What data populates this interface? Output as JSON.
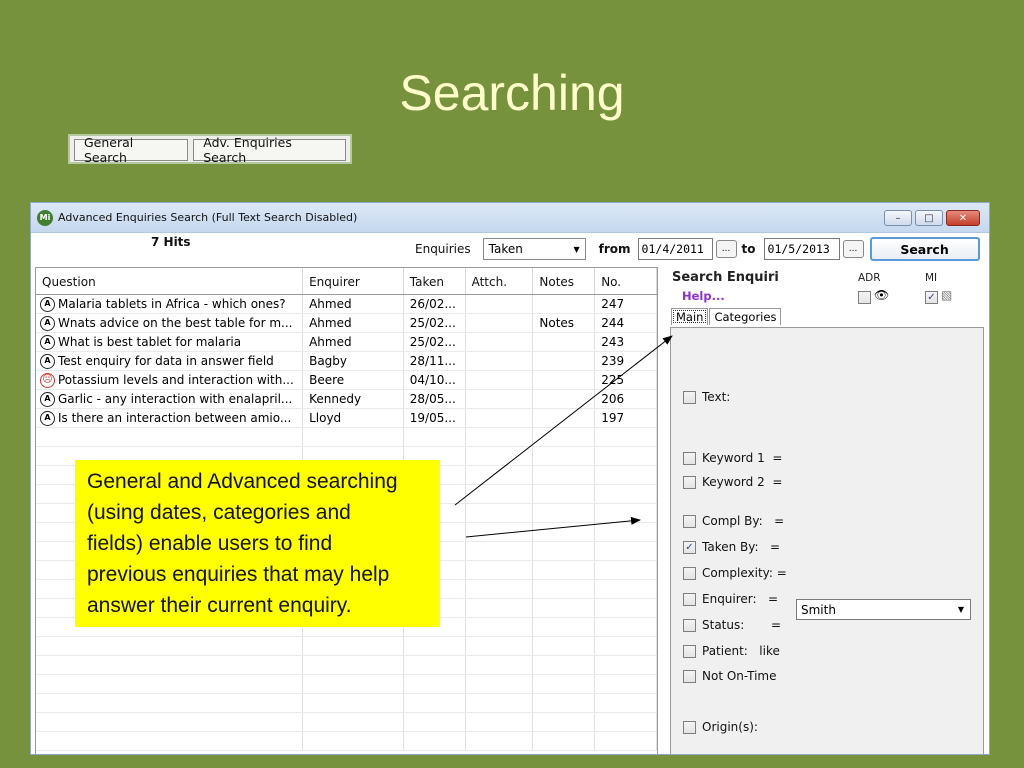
{
  "slide": {
    "title": "Searching"
  },
  "top_buttons": {
    "general": "General Search",
    "advanced": "Adv. Enquiries Search"
  },
  "window": {
    "title": "Advanced Enquiries Search (Full Text Search Disabled)",
    "icon_text": "Mi",
    "controls": {
      "minimize": "–",
      "maximize": "□",
      "close": "✕"
    }
  },
  "toolbar": {
    "hits": "7 Hits",
    "enquiries_label": "Enquiries",
    "enquiries_select": "Taken",
    "from_label": "from",
    "from_date": "01/4/2011",
    "dots": "...",
    "to_label": "to",
    "to_date": "01/5/2013",
    "search_button": "Search"
  },
  "results": {
    "columns": [
      "Question",
      "Enquirer",
      "Taken",
      "Attch.",
      "Notes",
      "No."
    ],
    "rows": [
      {
        "icon": "A",
        "question": "Malaria tablets in Africa - which ones?",
        "enquirer": "Ahmed",
        "taken": "26/02...",
        "attch": "",
        "notes": "",
        "no": "247"
      },
      {
        "icon": "A",
        "question": "Wnats advice on the best table for m...",
        "enquirer": "Ahmed",
        "taken": "25/02...",
        "attch": "",
        "notes": "Notes",
        "no": "244"
      },
      {
        "icon": "A",
        "question": "What is best tablet for malaria",
        "enquirer": "Ahmed",
        "taken": "25/02...",
        "attch": "",
        "notes": "",
        "no": "243"
      },
      {
        "icon": "A",
        "question": "Test enquiry for data in answer field",
        "enquirer": "Bagby",
        "taken": "28/11...",
        "attch": "",
        "notes": "",
        "no": "239"
      },
      {
        "icon": "sad",
        "question": "Potassium levels and interaction with...",
        "enquirer": "Beere",
        "taken": "04/10...",
        "attch": "",
        "notes": "",
        "no": "225"
      },
      {
        "icon": "A",
        "question": "Garlic - any interaction with enalapril...",
        "enquirer": "Kennedy",
        "taken": "28/05...",
        "attch": "",
        "notes": "",
        "no": "206"
      },
      {
        "icon": "A",
        "question": "Is there an interaction between amio...",
        "enquirer": "Lloyd",
        "taken": "19/05...",
        "attch": "",
        "notes": "",
        "no": "197"
      }
    ],
    "empty_rows": 17
  },
  "panel": {
    "title": "Search Enquiri",
    "help": "Help...",
    "adr_label": "ADR",
    "mi_label": "MI",
    "adr_checked": false,
    "mi_checked": true,
    "tabs": [
      "Main",
      "Categories"
    ],
    "fields": [
      {
        "label": "Text:",
        "checked": false
      },
      {
        "label": "Keyword 1  =",
        "checked": false
      },
      {
        "label": "Keyword 2  =",
        "checked": false
      },
      {
        "label": "Compl By:   =",
        "checked": false
      },
      {
        "label": "Taken By:   =",
        "checked": true
      },
      {
        "label": "Complexity: =",
        "checked": false
      },
      {
        "label": "Enquirer:   =",
        "checked": false
      },
      {
        "label": "Status:       =",
        "checked": false
      },
      {
        "label": "Patient:   like",
        "checked": false
      },
      {
        "label": "Not On-Time",
        "checked": false
      },
      {
        "label": "Origin(s):",
        "checked": false
      }
    ],
    "taken_by_value": "Smith"
  },
  "callout": {
    "lines": [
      "General and Advanced searching",
      "(using dates, categories and",
      "fields) enable users to find",
      "previous enquiries that may help",
      "answer their current enquiry."
    ]
  }
}
